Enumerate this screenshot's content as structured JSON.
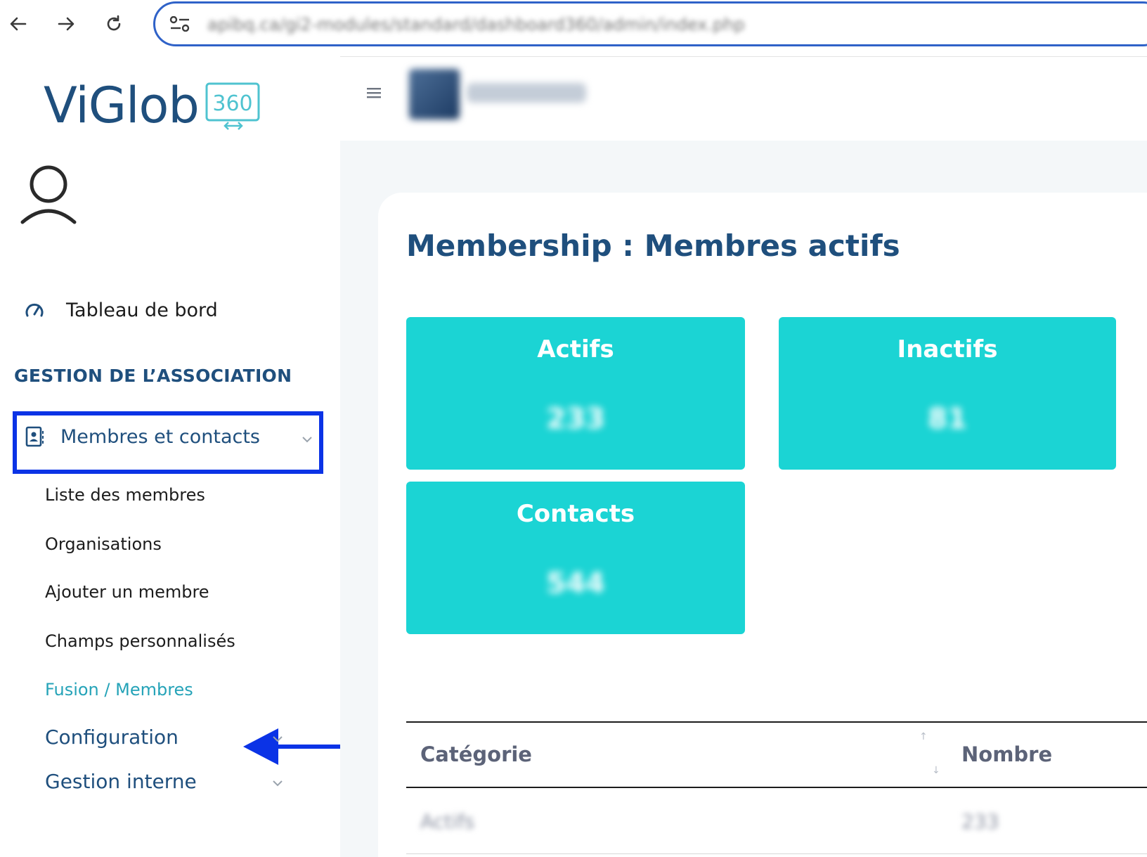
{
  "browser": {
    "url": "apibq.ca/gi2-modules/standard/dashboard360/admin/index.php",
    "back_icon": "arrow-left-icon",
    "forward_icon": "arrow-right-icon",
    "reload_icon": "reload-icon"
  },
  "brand": {
    "logo_text": "ViGlob",
    "badge_text": "360"
  },
  "sidebar": {
    "dashboard_label": "Tableau de bord",
    "section_title": "GESTION DE L’ASSOCIATION",
    "group_label": "Membres et contacts",
    "sub_items": [
      {
        "label": "Liste des membres"
      },
      {
        "label": "Organisations"
      },
      {
        "label": "Ajouter un membre"
      },
      {
        "label": "Champs personnalisés"
      },
      {
        "label": "Fusion / Membres"
      }
    ],
    "groups": [
      {
        "label": "Configuration"
      },
      {
        "label": "Gestion interne"
      }
    ]
  },
  "main": {
    "title": "Membership : Membres actifs",
    "stats": [
      {
        "label": "Actifs",
        "value": "233"
      },
      {
        "label": "Inactifs",
        "value": "81"
      },
      {
        "label": "Contacts",
        "value": "544"
      }
    ],
    "table": {
      "headers": [
        "Catégorie",
        "Nombre"
      ],
      "rows": [
        [
          "Actifs",
          "233"
        ]
      ]
    }
  },
  "colors": {
    "accent": "#1bd4d4",
    "brand_blue": "#1f4f7d",
    "highlight": "#0b33e6",
    "active_link": "#25a3b8"
  }
}
